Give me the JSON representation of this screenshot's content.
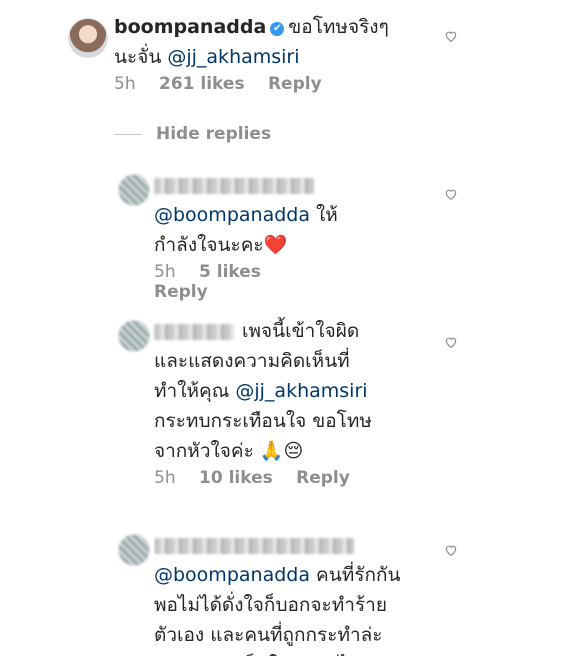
{
  "comments": [
    {
      "username": "boompanadda",
      "verified_mark": "✔",
      "text": "ขอโทษจริงๆ นะจั่น ",
      "mention": "@jj_akhamsiri",
      "time": "5h",
      "likes": "261 likes",
      "reply": "Reply"
    }
  ],
  "hide_replies": "Hide replies",
  "replies": [
    {
      "mention": "@boompanadda",
      "text": " ให้กำลังใจนะคะ",
      "emoji": "❤️",
      "time": "5h",
      "likes": "5 likes",
      "reply": "Reply"
    },
    {
      "text_a": "เพจนี้เข้าใจผิดและแสดงความคิดเห็นที่ทำให้คุณ ",
      "mention": "@jj_akhamsiri",
      "text_b": " กระทบกระเทือนใจ ขอโทษจากหัวใจค่ะ",
      "emoji": "🙏😔",
      "time": "5h",
      "likes": "10 likes",
      "reply": "Reply"
    },
    {
      "mention": "@boompanadda",
      "text": " คนที่รักกันพอไม่ได้ดั่งใจก็บอกจะทำร้ายตัวเอง และคนที่ถูกกระทำล่ะคะ เขาน่าเห็นใจขนาดไหน"
    }
  ],
  "icons": {
    "like": "heart-outline-icon"
  }
}
